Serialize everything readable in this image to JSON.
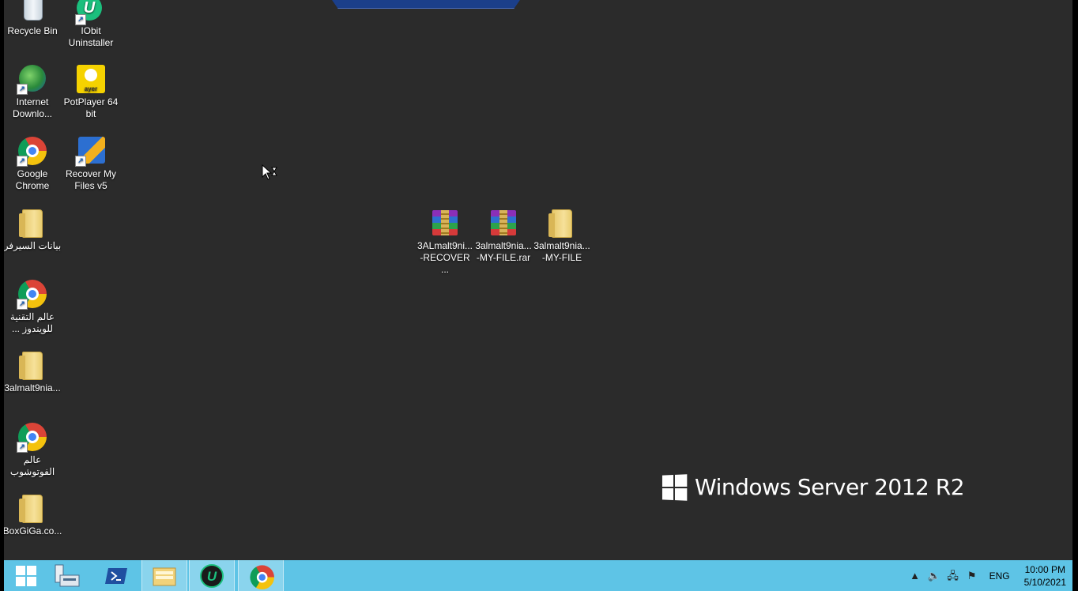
{
  "desktop": {
    "background_color": "#2b2b2b",
    "top_bar_label": "",
    "left_icons": [
      {
        "label": "Recycle Bin",
        "icon": "recycle-bin-icon"
      },
      {
        "label": "IObit\nUninstaller",
        "icon": "iobit-uninstaller-icon"
      },
      {
        "label": "Internet\nDownlo...",
        "icon": "internet-download-manager-icon"
      },
      {
        "label": "PotPlayer 64\nbit",
        "icon": "potplayer-icon"
      },
      {
        "label": "Google\nChrome",
        "icon": "chrome-icon"
      },
      {
        "label": "Recover My\nFiles v5",
        "icon": "recover-my-files-icon"
      },
      {
        "label": "بيانات السيرفر",
        "icon": "folder-icon"
      },
      {
        "label": "عالم التقنية\nللويندوز ...",
        "icon": "chrome-shortcut-icon"
      },
      {
        "label": "3almalt9nia...",
        "icon": "folder-icon"
      },
      {
        "label": "عالم\nالفوتوشوب",
        "icon": "chrome-shortcut-icon"
      },
      {
        "label": "BoxGiGa.co...",
        "icon": "folder-icon"
      }
    ],
    "center_icons": [
      {
        "label": "3ALmalt9ni...\n-RECOVER ...",
        "icon": "winrar-archive-icon"
      },
      {
        "label": "3almalt9nia...\n-MY-FILE.rar",
        "icon": "winrar-archive-icon"
      },
      {
        "label": "3almalt9nia...\n-MY-FILE",
        "icon": "folder-icon"
      }
    ],
    "branding": "Windows Server 2012 R2"
  },
  "taskbar": {
    "color": "#5ec4e6",
    "buttons": [
      {
        "name": "start-button",
        "icon": "windows-start-icon"
      },
      {
        "name": "server-manager-button",
        "icon": "server-manager-icon"
      },
      {
        "name": "powershell-button",
        "icon": "powershell-icon"
      },
      {
        "name": "file-explorer-button",
        "icon": "file-explorer-icon"
      },
      {
        "name": "iobit-taskbar-button",
        "icon": "iobit-uninstaller-icon"
      },
      {
        "name": "chrome-taskbar-button",
        "icon": "chrome-icon",
        "active": true
      }
    ],
    "tray": {
      "language": "ENG",
      "time": "10:00 PM",
      "date": "5/10/2021"
    }
  }
}
